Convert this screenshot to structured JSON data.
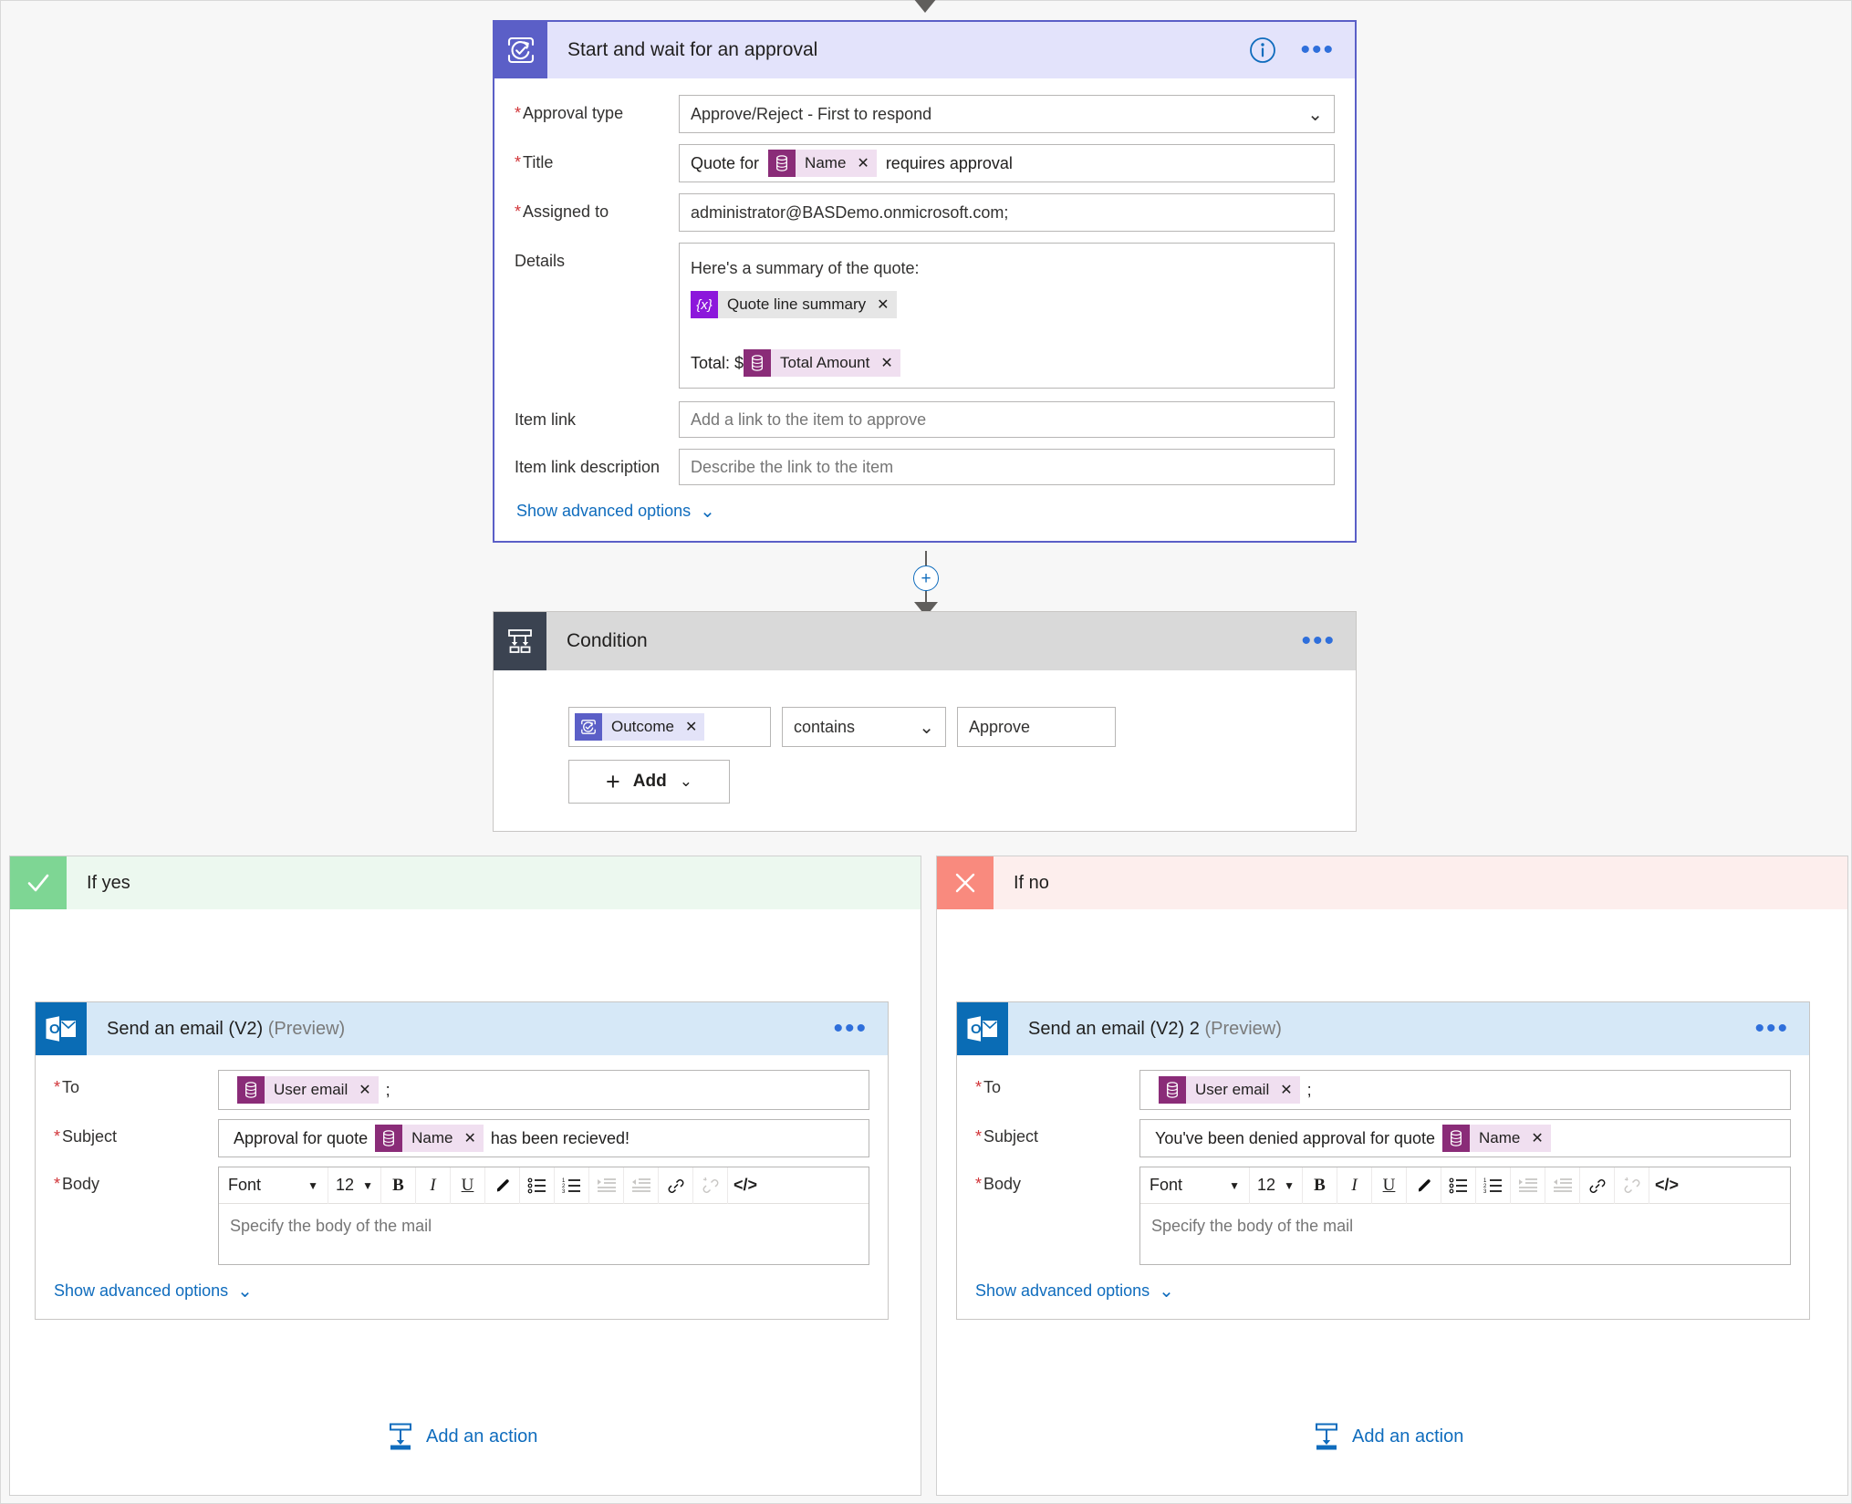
{
  "flow": {
    "approval_card": {
      "title": "Start and wait for an approval",
      "icon": "approval-icon",
      "info_icon": "info-icon",
      "more_icon": "more-options-icon",
      "fields": {
        "approval_type": {
          "label": "Approval type",
          "required": true,
          "value": "Approve/Reject - First to respond",
          "chevron": "chevron-down-icon"
        },
        "title": {
          "label": "Title",
          "required": true,
          "prefix": "Quote for",
          "token": "Name",
          "suffix": "requires approval"
        },
        "assigned_to": {
          "label": "Assigned to",
          "required": true,
          "value": "administrator@BASDemo.onmicrosoft.com;"
        },
        "details": {
          "label": "Details",
          "required": false,
          "line1": "Here's a summary of the quote:",
          "token1": "Quote line summary",
          "line2_prefix": "Total: $",
          "token2": "Total Amount"
        },
        "item_link": {
          "label": "Item link",
          "required": false,
          "placeholder": "Add a link to the item to approve"
        },
        "item_link_description": {
          "label": "Item link description",
          "required": false,
          "placeholder": "Describe the link to the item"
        }
      },
      "show_advanced": "Show advanced options"
    },
    "add_node_icon": "add-step-plus-icon",
    "condition_card": {
      "title": "Condition",
      "icon": "condition-icon",
      "more_icon": "more-options-icon",
      "operand_token": "Outcome",
      "operator": "contains",
      "operator_chevron": "chevron-down-icon",
      "value": "Approve",
      "add_label": "Add",
      "add_plus_icon": "plus-icon",
      "add_chevron_icon": "chevron-down-icon"
    },
    "branches": [
      {
        "key": "yes",
        "label": "If yes",
        "badge_icon": "check-icon",
        "mail": {
          "title": "Send an email (V2)",
          "title_suffix": "(Preview)",
          "icon": "outlook-icon",
          "more_icon": "more-options-icon",
          "to": {
            "label": "To",
            "token": "User email",
            "trailing": ";"
          },
          "subject": {
            "label": "Subject",
            "prefix": "Approval for quote",
            "token": "Name",
            "suffix": "has been recieved!"
          },
          "body": {
            "label": "Body",
            "placeholder": "Specify the body of the mail"
          },
          "show_advanced": "Show advanced options"
        },
        "add_action": "Add an action",
        "add_action_icon": "add-action-icon"
      },
      {
        "key": "no",
        "label": "If no",
        "badge_icon": "close-icon",
        "mail": {
          "title": "Send an email (V2) 2",
          "title_suffix": "(Preview)",
          "icon": "outlook-icon",
          "more_icon": "more-options-icon",
          "to": {
            "label": "To",
            "token": "User email",
            "trailing": ";"
          },
          "subject": {
            "label": "Subject",
            "prefix": "You've been denied approval for quote",
            "token": "Name",
            "suffix": ""
          },
          "body": {
            "label": "Body",
            "placeholder": "Specify the body of the mail"
          },
          "show_advanced": "Show advanced options"
        },
        "add_action": "Add an action",
        "add_action_icon": "add-action-icon"
      }
    ],
    "editor_toolbar": {
      "font_label": "Font",
      "size_label": "12",
      "buttons": [
        {
          "name": "bold-icon",
          "glyph": "B"
        },
        {
          "name": "italic-icon",
          "glyph": "I"
        },
        {
          "name": "underline-icon",
          "glyph": "U"
        },
        {
          "name": "highlight-pen-icon",
          "glyph": "✎"
        },
        {
          "name": "bulleted-list-icon",
          "glyph": "☰"
        },
        {
          "name": "numbered-list-icon",
          "glyph": "☰"
        },
        {
          "name": "indent-icon",
          "glyph": "→☰"
        },
        {
          "name": "outdent-icon",
          "glyph": "←☰"
        },
        {
          "name": "link-icon",
          "glyph": "🔗"
        },
        {
          "name": "unlink-icon",
          "glyph": "🔗"
        },
        {
          "name": "code-view-icon",
          "glyph": "</>"
        }
      ]
    },
    "colors": {
      "approval_accent": "#5b5fc7",
      "approval_header_bg": "#e3e3fb",
      "condition_accent": "#3b4351",
      "condition_header_bg": "#d9d9d9",
      "outlook_blue": "#0a6cb5",
      "mail_header_bg": "#d6e8f7",
      "yes_green": "#7ed694",
      "no_red": "#f98a7e",
      "link_blue": "#0f6cbd",
      "cds_token": "#8a2c78",
      "variable_token": "#8c17db",
      "required_asterisk": "#d13438"
    }
  }
}
